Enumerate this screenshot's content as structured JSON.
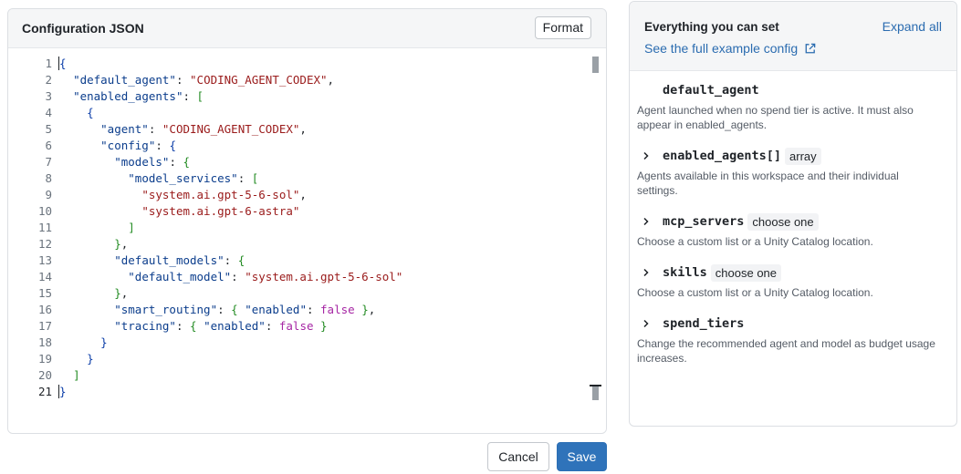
{
  "editor": {
    "title": "Configuration JSON",
    "format_label": "Format",
    "lines": [
      {
        "n": "1",
        "html": "<span class=\"p1 cursor\">{</span>"
      },
      {
        "n": "2",
        "html": "  <span class=\"k\">\"default_agent\"</span>: <span class=\"s\">\"CODING_AGENT_CODEX\"</span>,"
      },
      {
        "n": "3",
        "html": "  <span class=\"k\">\"enabled_agents\"</span>: <span class=\"p2\">[</span>"
      },
      {
        "n": "4",
        "html": "    <span class=\"p3\">{</span>"
      },
      {
        "n": "5",
        "html": "      <span class=\"k\">\"agent\"</span>: <span class=\"s\">\"CODING_AGENT_CODEX\"</span>,"
      },
      {
        "n": "6",
        "html": "      <span class=\"k\">\"config\"</span>: <span class=\"p1\">{</span>"
      },
      {
        "n": "7",
        "html": "        <span class=\"k\">\"models\"</span>: <span class=\"p2\">{</span>"
      },
      {
        "n": "8",
        "html": "          <span class=\"k\">\"model_services\"</span>: <span class=\"p2\">[</span>"
      },
      {
        "n": "9",
        "html": "            <span class=\"s\">\"system.ai.gpt-5-6-sol\"</span>,"
      },
      {
        "n": "10",
        "html": "            <span class=\"s\">\"system.ai.gpt-6-astra\"</span>"
      },
      {
        "n": "11",
        "html": "          <span class=\"p2\">]</span>"
      },
      {
        "n": "12",
        "html": "        <span class=\"p2\">}</span>,"
      },
      {
        "n": "13",
        "html": "        <span class=\"k\">\"default_models\"</span>: <span class=\"p2\">{</span>"
      },
      {
        "n": "14",
        "html": "          <span class=\"k\">\"default_model\"</span>: <span class=\"s\">\"system.ai.gpt-5-6-sol\"</span>"
      },
      {
        "n": "15",
        "html": "        <span class=\"p2\">}</span>,"
      },
      {
        "n": "16",
        "html": "        <span class=\"k\">\"smart_routing\"</span>: <span class=\"p2\">{</span> <span class=\"k\">\"enabled\"</span>: <span class=\"b\">false</span> <span class=\"p2\">}</span>,"
      },
      {
        "n": "17",
        "html": "        <span class=\"k\">\"tracing\"</span>: <span class=\"p2\">{</span> <span class=\"k\">\"enabled\"</span>: <span class=\"b\">false</span> <span class=\"p2\">}</span>"
      },
      {
        "n": "18",
        "html": "      <span class=\"p1\">}</span>"
      },
      {
        "n": "19",
        "html": "    <span class=\"p3\">}</span>"
      },
      {
        "n": "20",
        "html": "  <span class=\"p2\">]</span>"
      },
      {
        "n": "21",
        "html": "<span class=\"p1 cursor\">}</span>"
      }
    ],
    "active_line": "21"
  },
  "footer": {
    "cancel_label": "Cancel",
    "save_label": "Save"
  },
  "reference": {
    "title": "Everything you can set",
    "expand_all_label": "Expand all",
    "example_link_label": "See the full example config",
    "fields": [
      {
        "name": "default_agent",
        "type": "",
        "expandable": false,
        "desc": "Agent launched when no spend tier is active. It must also appear in enabled_agents."
      },
      {
        "name": "enabled_agents[]",
        "type": "array",
        "expandable": true,
        "desc": "Agents available in this workspace and their individual settings."
      },
      {
        "name": "mcp_servers",
        "type": "choose one",
        "expandable": true,
        "desc": "Choose a custom list or a Unity Catalog location."
      },
      {
        "name": "skills",
        "type": "choose one",
        "expandable": true,
        "desc": "Choose a custom list or a Unity Catalog location."
      },
      {
        "name": "spend_tiers",
        "type": "",
        "expandable": true,
        "desc": "Change the recommended agent and model as budget usage increases."
      }
    ]
  }
}
